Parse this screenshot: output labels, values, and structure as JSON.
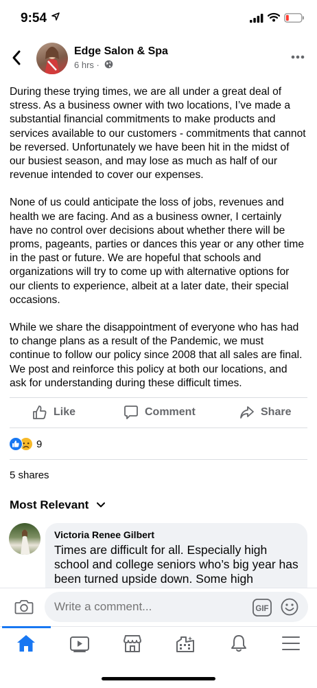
{
  "status_bar": {
    "time": "9:54"
  },
  "post": {
    "page_name": "Edge Salon & Spa",
    "time": "6 hrs ·",
    "paragraphs": [
      "During these trying times, we are all under a great deal of stress. As a business owner with two locations, I’ve made a substantial financial commitments to make products and services available to our customers - commitments that cannot be reversed. Unfortunately we have been hit in the midst of our busiest season, and may lose as much as half of our revenue intended to cover our expenses.",
      "None of us could anticipate the loss of jobs, revenues and health we are facing. And as a business owner, I certainly have no control over decisions about whether there will be proms, pageants, parties or dances this year or any other time in the past or future.  We are hopeful that schools and organizations will try to come up with alternative options for our clients to experience, albeit at a later date, their special occasions.",
      "While we share the disappointment of everyone who has had to change plans as a result of the Pandemic, we must continue to follow our policy since 2008 that all sales are final. We post and reinforce this policy at both our locations, and ask for understanding during these difficult times."
    ]
  },
  "actions": {
    "like": "Like",
    "comment": "Comment",
    "share": "Share"
  },
  "reactions": {
    "count": "9"
  },
  "shares": "5 shares",
  "sort_label": "Most Relevant",
  "comment": {
    "author": "Victoria Renee Gilbert",
    "text": "Times are difficult for all. Especially high school and college seniors who’s big year has been turned upside down. Some high"
  },
  "composer": {
    "placeholder": "Write a comment...",
    "gif_label": "GIF"
  },
  "colors": {
    "accent": "#1877f2",
    "secondary_text": "#65676b",
    "bubble": "#f0f2f5"
  }
}
